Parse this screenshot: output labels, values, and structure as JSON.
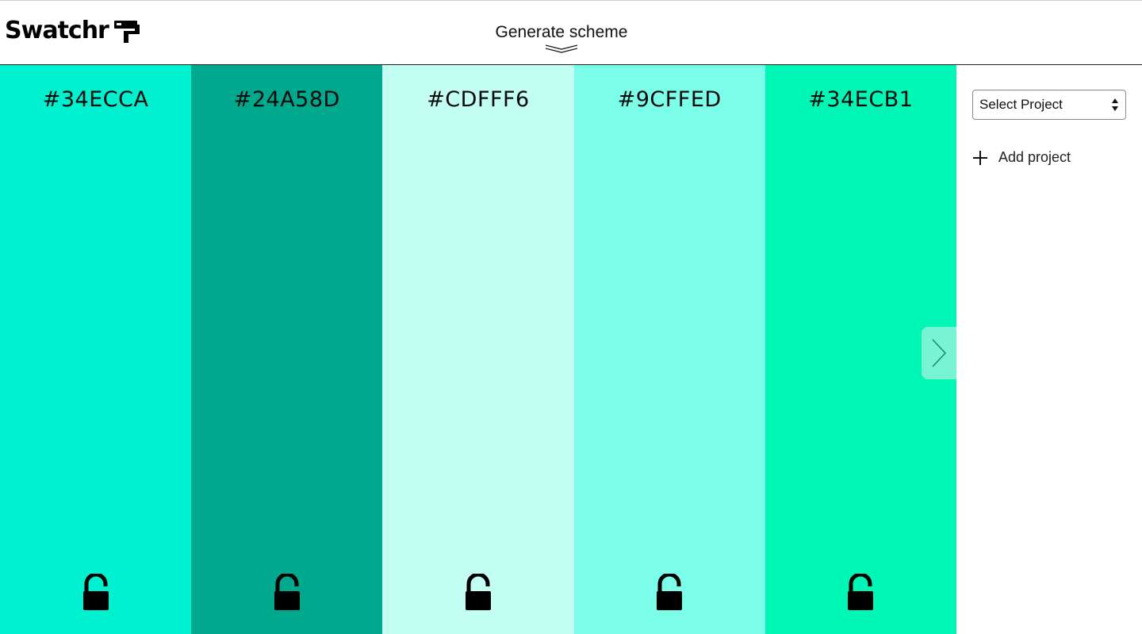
{
  "app": {
    "name": "Swatchr"
  },
  "header": {
    "generate_label": "Generate scheme"
  },
  "palette": {
    "swatches": [
      {
        "hex": "#34ECCA",
        "color": "#00F1CF",
        "locked": false
      },
      {
        "hex": "#24A58D",
        "color": "#00A98E",
        "locked": false
      },
      {
        "hex": "#CDFFF6",
        "color": "#C3FEF2",
        "locked": false
      },
      {
        "hex": "#9CFFED",
        "color": "#7BFDEA",
        "locked": false
      },
      {
        "hex": "#34ECB1",
        "color": "#00F7B6",
        "locked": false
      }
    ],
    "next_button_color": "#78F3D4"
  },
  "sidebar": {
    "select_project_label": "Select Project",
    "add_project_label": "Add project"
  },
  "icons": {
    "logo": "paint-roller-icon",
    "chevrons": "double-chevron-down-icon",
    "lock": "unlocked-padlock-icon",
    "next": "chevron-right-icon",
    "add": "plus-icon",
    "select": "up-down-arrows-icon"
  }
}
